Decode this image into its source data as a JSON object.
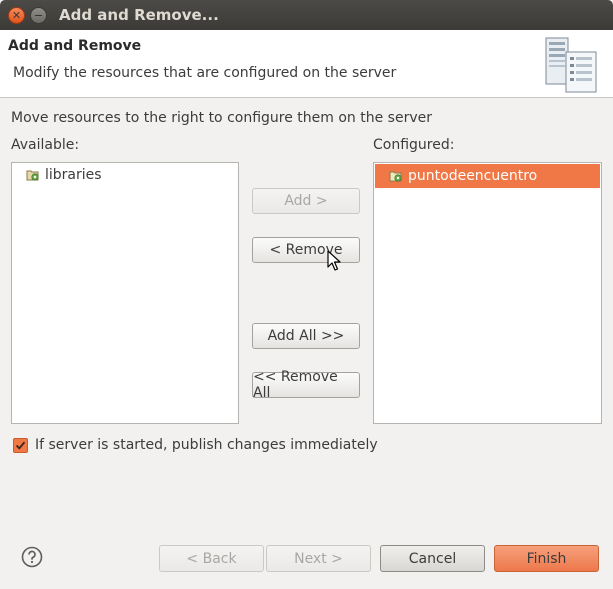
{
  "window": {
    "title": "Add and Remove..."
  },
  "header": {
    "title": "Add and Remove",
    "subtitle": "Modify the resources that are configured on the server",
    "icon": "server-icon"
  },
  "instructions": "Move resources to the right to configure them on the server",
  "available": {
    "label": "Available:",
    "items": [
      {
        "label": "libraries",
        "icon": "project-icon"
      }
    ]
  },
  "configured": {
    "label": "Configured:",
    "items": [
      {
        "label": "puntodeencuentro",
        "icon": "project-icon",
        "selected": true
      }
    ]
  },
  "buttons": {
    "add": "Add >",
    "remove": "< Remove",
    "add_all": "Add All >>",
    "remove_all": "<< Remove All"
  },
  "publish_option": {
    "label": "If server is started, publish changes immediately",
    "checked": true
  },
  "footer": {
    "back": "< Back",
    "next": "Next >",
    "cancel": "Cancel",
    "finish": "Finish"
  },
  "colors": {
    "accent": "#f07746",
    "titlebar": "#3c3b37"
  }
}
